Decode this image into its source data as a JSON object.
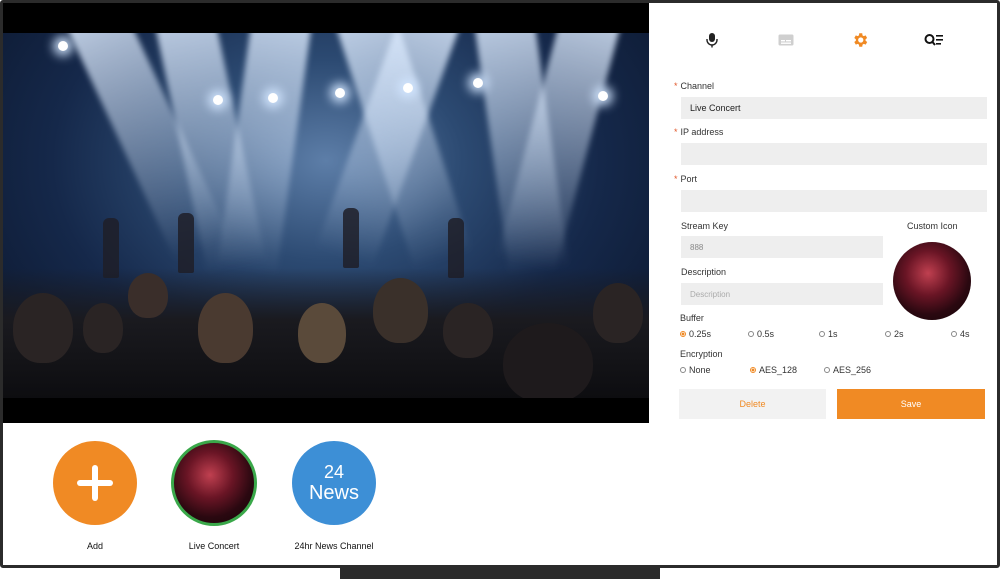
{
  "tabs": [
    {
      "icon": "microphone-icon"
    },
    {
      "icon": "caption-icon"
    },
    {
      "icon": "gear-icon",
      "active": true
    },
    {
      "icon": "search-list-icon"
    }
  ],
  "form": {
    "channel": {
      "label": "Channel",
      "value": "Live Concert"
    },
    "ip_address": {
      "label": "IP address",
      "value": ""
    },
    "port": {
      "label": "Port",
      "value": ""
    },
    "stream_key": {
      "label": "Stream Key",
      "value": "888"
    },
    "custom_icon_label": "Custom Icon",
    "description": {
      "label": "Description",
      "placeholder": "Description"
    },
    "buffer": {
      "label": "Buffer",
      "options": [
        "0.25s",
        "0.5s",
        "1s",
        "2s",
        "4s"
      ],
      "selected": "0.25s"
    },
    "encryption": {
      "label": "Encryption",
      "options": [
        "None",
        "AES_128",
        "AES_256"
      ],
      "selected": "AES_128"
    },
    "delete_label": "Delete",
    "save_label": "Save"
  },
  "channels": [
    {
      "label": "Add",
      "icon": "plus-icon"
    },
    {
      "label": "Live Concert",
      "selected": true
    },
    {
      "label": "24hr News Channel",
      "badge_top": "24",
      "badge_bottom": "News"
    }
  ],
  "colors": {
    "accent": "#f08a24",
    "news_blue": "#3d8fd6",
    "selected_ring": "#3aa84a",
    "field_bg": "#eeeeee"
  }
}
